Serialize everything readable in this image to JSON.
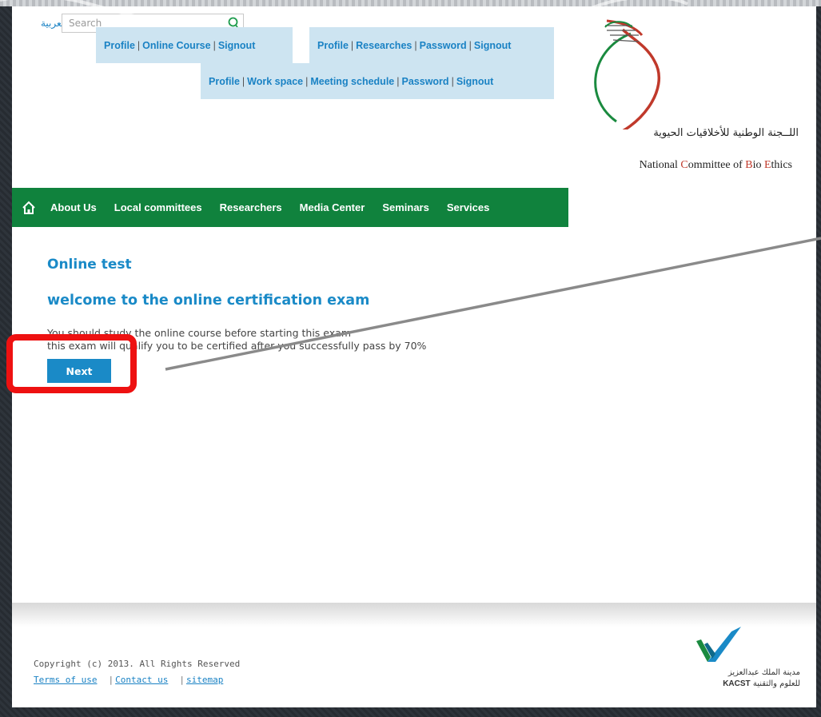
{
  "header": {
    "language_link": "العربية",
    "search_placeholder": "Search",
    "userbar1": [
      "Profile",
      "Online Course",
      "Signout"
    ],
    "userbar2": [
      "Profile",
      "Researches",
      "Password",
      "Signout"
    ],
    "userbar3": [
      "Profile",
      "Work space",
      "Meeting schedule",
      "Password",
      "Signout"
    ],
    "separator": "|"
  },
  "logo": {
    "arabic_name": "اللــجنة الوطنية للأخلاقيات الحيوية",
    "english_parts": [
      "National ",
      "C",
      "ommittee of ",
      "B",
      "io ",
      "E",
      "thics"
    ]
  },
  "nav": {
    "items": [
      "About Us",
      "Local committees",
      "Researchers",
      "Media Center",
      "Seminars",
      "Services"
    ]
  },
  "main": {
    "heading": "Online test",
    "subheading": "welcome to the online certification exam",
    "line1": "You should study the online course before starting this exam",
    "line2": "this exam will qualify you to be certified after you successfully pass by 70%",
    "next_label": "Next"
  },
  "footer": {
    "copyright": "Copyright (c) 2013. All Rights Reserved",
    "links": [
      "Terms of use",
      "Contact us",
      "sitemap"
    ],
    "kacst_ar1": "مدينة الملك عبدالعزيز",
    "kacst_ar2_prefix": "KACST",
    "kacst_ar2": "للعلوم والتقنية"
  },
  "colors": {
    "accent_blue": "#1a8ac7",
    "nav_green": "#10823d",
    "userbar_bg": "#cde4f1",
    "highlight_red": "#ee1111"
  }
}
